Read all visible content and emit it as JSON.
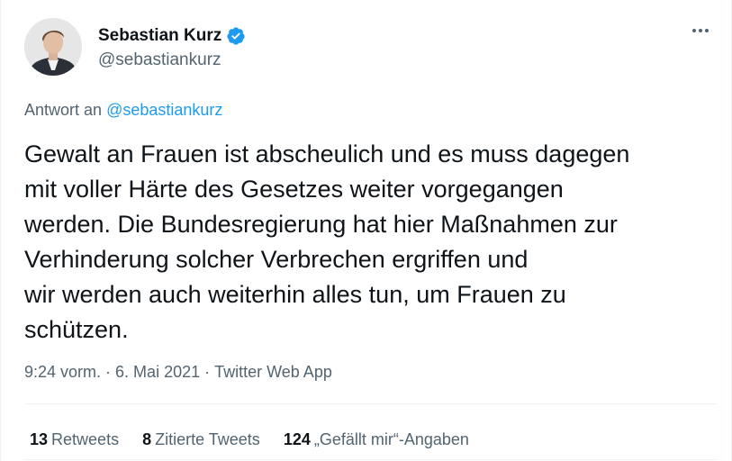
{
  "author": {
    "display_name": "Sebastian Kurz",
    "handle": "@sebastiankurz",
    "verified_icon": "verified-badge-icon",
    "verified_color": "#1d9bf0"
  },
  "reply": {
    "prefix": "Antwort an",
    "to": "@sebastiankurz"
  },
  "tweet": {
    "text": "Gewalt an Frauen ist abscheulich und es muss dagegen\nmit voller Härte des Gesetzes weiter vorgegangen\nwerden. Die Bundesregierung hat hier Maßnahmen zur\nVerhinderung solcher Verbrechen ergriffen und\nwir werden auch weiterhin alles tun, um Frauen zu\nschützen.",
    "time": "9:24 vorm.",
    "date": "6. Mai 2021",
    "separator": "·",
    "source": "Twitter Web App"
  },
  "stats": {
    "retweets_count": "13",
    "retweets_label": "Retweets",
    "quotes_count": "8",
    "quotes_label": "Zitierte Tweets",
    "likes_count": "124",
    "likes_label": "„Gefällt mir“-Angaben"
  },
  "colors": {
    "accent": "#1d9bf0",
    "text": "#0f1419",
    "secondary": "#536471"
  }
}
